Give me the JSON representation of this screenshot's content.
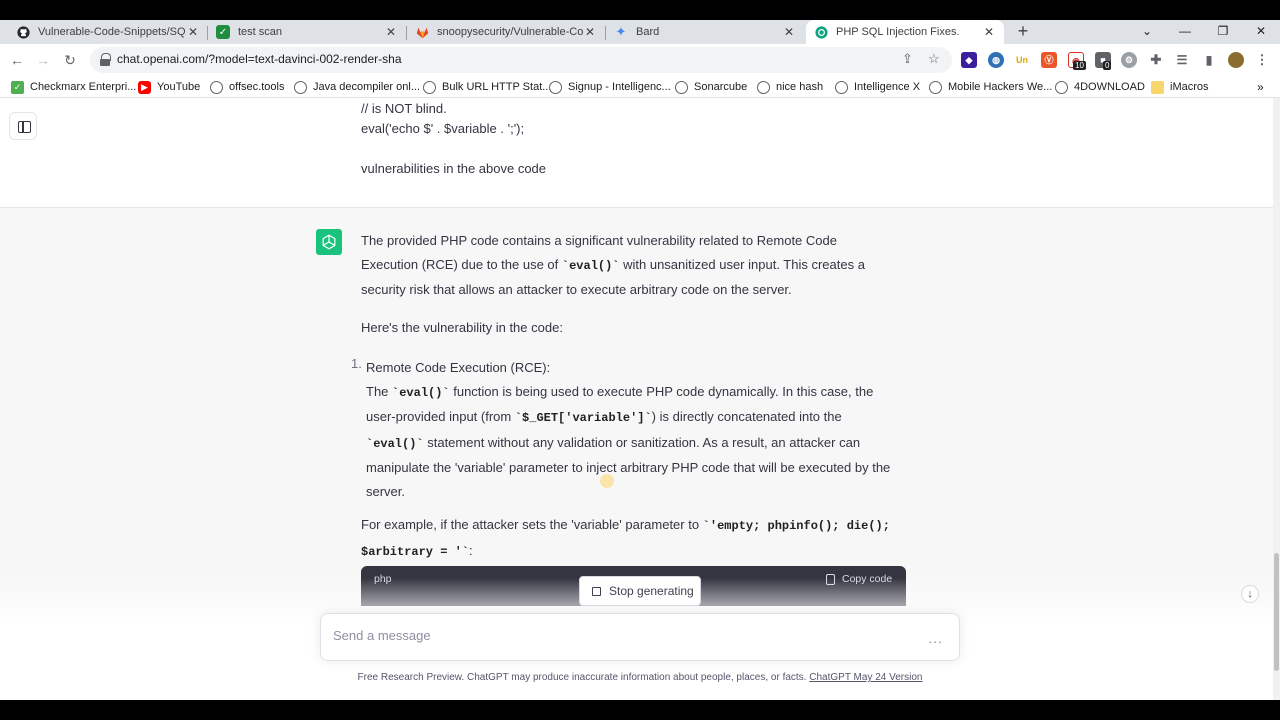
{
  "browser": {
    "tabs": [
      {
        "title": "Vulnerable-Code-Snippets/SQL I",
        "icon": "github-icon"
      },
      {
        "title": "test scan",
        "icon": "checkmark-icon"
      },
      {
        "title": "snoopysecurity/Vulnerable-Code",
        "icon": "gitlab-icon"
      },
      {
        "title": "Bard",
        "icon": "bard-sparkle-icon"
      },
      {
        "title": "PHP SQL Injection Fixes.",
        "icon": "openai-icon",
        "active": true
      }
    ],
    "url": "chat.openai.com/?model=text-davinci-002-render-sha",
    "extension_badges": [
      "10",
      "0"
    ],
    "bookmarks": [
      "Checkmarx Enterpri...",
      "YouTube",
      "offsec.tools",
      "Java decompiler onl...",
      "Bulk URL HTTP Stat...",
      "Signup - Intelligenc...",
      "Sonarcube",
      "nice hash",
      "Intelligence X",
      "Mobile Hackers We...",
      "4DOWNLOAD",
      "iMacros"
    ]
  },
  "user_message": {
    "lines": [
      "// is NOT blind.",
      "eval('echo $' . $variable . ';');",
      "vulnerabilities in the above code"
    ]
  },
  "assistant_message": {
    "intro": {
      "l1": "The provided PHP code contains a significant vulnerability related to Remote Code",
      "l2a": "Execution (RCE) due to the use of ",
      "l2code": "`eval()`",
      "l2b": " with unsanitized user input. This creates a",
      "l3": "security risk that allows an attacker to execute arbitrary code on the server."
    },
    "heading": "Here's the vulnerability in the code:",
    "item1": {
      "number": "1.",
      "title": "Remote Code Execution (RCE):",
      "l1a": "The ",
      "l1code": "`eval()`",
      "l1b": " function is being used to execute PHP code dynamically. In this case, the",
      "l2a": "user-provided input (from ",
      "l2code": "`$_GET['variable']`",
      "l2b": ") is directly concatenated into the",
      "l3code": "`eval()`",
      "l3b": " statement without any validation or sanitization. As a result, an attacker can",
      "l4": "manipulate the 'variable' parameter to inject arbitrary PHP code that will be executed by the",
      "l5": "server."
    },
    "example": {
      "l1a": "For example, if the attacker sets the 'variable' parameter to ",
      "l1code": "`'empty; phpinfo(); die();",
      "l2code": "$arbitrary = '`",
      "l2b": ":"
    },
    "codeblock": {
      "language": "php",
      "copy_label": "Copy code"
    }
  },
  "composer": {
    "stop_label": "Stop generating",
    "placeholder": "Send a message",
    "dots": "..."
  },
  "footer": {
    "text": "Free Research Preview. ChatGPT may produce inaccurate information about people, places, or facts. ",
    "link": "ChatGPT May 24 Version"
  }
}
